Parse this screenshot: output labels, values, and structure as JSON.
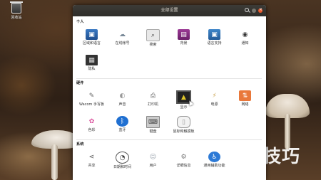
{
  "desktop": {
    "trash_label": "回收站",
    "watermark": "软件技巧"
  },
  "window": {
    "title": "全部设置"
  },
  "sections": [
    {
      "title": "个人",
      "items": [
        {
          "label": "区域和语言",
          "icon": "region-flag-icon",
          "glyph": "▣"
        },
        {
          "label": "在线帐号",
          "icon": "online-accounts-icon",
          "glyph": "☁"
        },
        {
          "label": "搜索",
          "icon": "search-settings-icon",
          "glyph": "⌕"
        },
        {
          "label": "背景",
          "icon": "background-icon",
          "glyph": "▤"
        },
        {
          "label": "语言支持",
          "icon": "language-support-icon",
          "glyph": "▣"
        },
        {
          "label": "通知",
          "icon": "notifications-icon",
          "glyph": "◉"
        },
        {
          "label": "隐私",
          "icon": "privacy-icon",
          "glyph": "▦"
        }
      ]
    },
    {
      "title": "硬件",
      "items": [
        {
          "label": "Wacom 手写板",
          "icon": "wacom-tablet-icon",
          "glyph": "✎"
        },
        {
          "label": "声音",
          "icon": "sound-icon",
          "glyph": "◐"
        },
        {
          "label": "打印机",
          "icon": "printer-icon",
          "glyph": "⎙"
        },
        {
          "label": "显示",
          "icon": "display-icon",
          "glyph": "▲"
        },
        {
          "label": "电源",
          "icon": "power-icon",
          "glyph": "⚡"
        },
        {
          "label": "网络",
          "icon": "network-icon",
          "glyph": "⇅"
        },
        {
          "label": "色彩",
          "icon": "color-icon",
          "glyph": "✿"
        },
        {
          "label": "蓝牙",
          "icon": "bluetooth-icon",
          "glyph": "ᛒ"
        },
        {
          "label": "键盘",
          "icon": "keyboard-icon",
          "glyph": "⌨"
        },
        {
          "label": "鼠标和触摸板",
          "icon": "mouse-touchpad-icon",
          "glyph": "▯"
        }
      ]
    },
    {
      "title": "系统",
      "items": [
        {
          "label": "共享",
          "icon": "sharing-icon",
          "glyph": "⋖"
        },
        {
          "label": "日期和时间",
          "icon": "date-time-icon",
          "glyph": "◔"
        },
        {
          "label": "用户",
          "icon": "users-icon",
          "glyph": "☺"
        },
        {
          "label": "详细信息",
          "icon": "details-gear-icon",
          "glyph": "⚙"
        },
        {
          "label": "通用辅助功能",
          "icon": "accessibility-icon",
          "glyph": "♿"
        }
      ]
    }
  ]
}
